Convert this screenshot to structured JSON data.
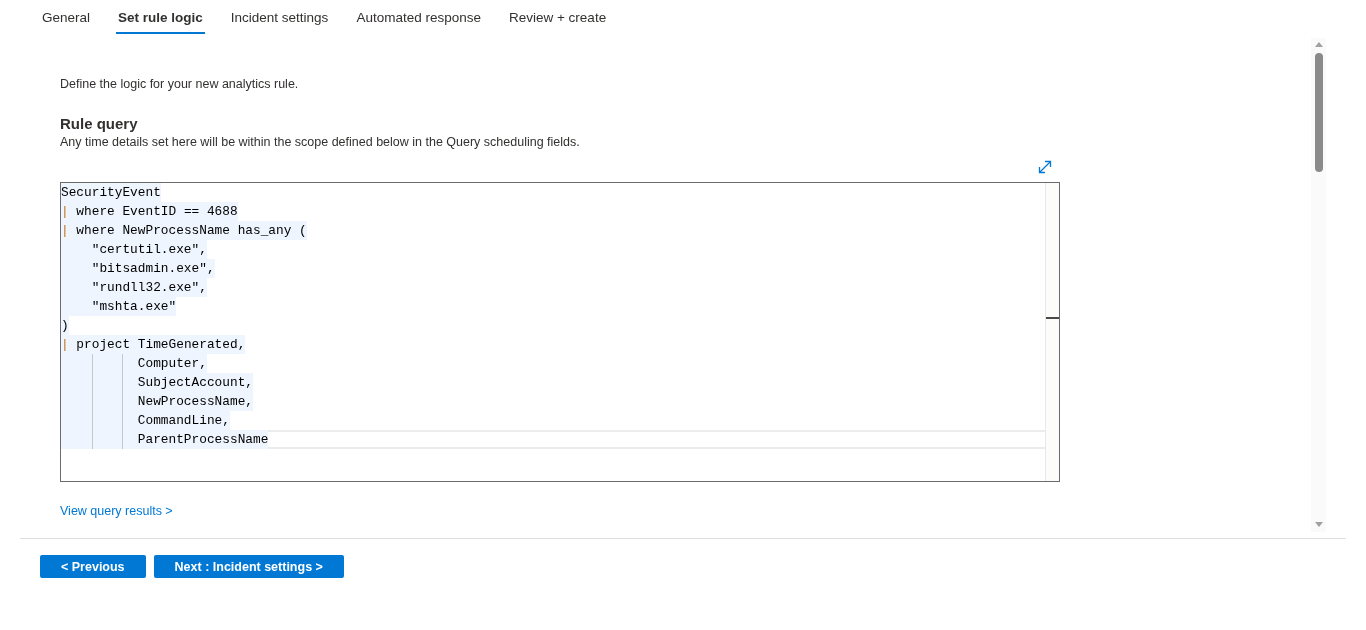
{
  "tabs": [
    {
      "label": "General",
      "selected": false
    },
    {
      "label": "Set rule logic",
      "selected": true
    },
    {
      "label": "Incident settings",
      "selected": false
    },
    {
      "label": "Automated response",
      "selected": false
    },
    {
      "label": "Review + create",
      "selected": false
    }
  ],
  "intro": "Define the logic for your new analytics rule.",
  "rule_query": {
    "title": "Rule query",
    "description": "Any time details set here will be within the scope defined below in the Query scheduling fields.",
    "editor": {
      "lines": [
        {
          "selected": true,
          "current": false,
          "segments": [
            {
              "kind": "plain",
              "text": "SecurityEvent"
            }
          ]
        },
        {
          "selected": true,
          "current": false,
          "segments": [
            {
              "kind": "operator",
              "text": "|"
            },
            {
              "kind": "plain",
              "text": " where EventID == 4688"
            }
          ]
        },
        {
          "selected": true,
          "current": false,
          "segments": [
            {
              "kind": "operator",
              "text": "|"
            },
            {
              "kind": "plain",
              "text": " where NewProcessName has_any ("
            }
          ]
        },
        {
          "selected": true,
          "current": false,
          "segments": [
            {
              "kind": "plain",
              "text": "    \"certutil.exe\","
            }
          ]
        },
        {
          "selected": true,
          "current": false,
          "segments": [
            {
              "kind": "plain",
              "text": "    \"bitsadmin.exe\","
            }
          ]
        },
        {
          "selected": true,
          "current": false,
          "segments": [
            {
              "kind": "plain",
              "text": "    \"rundll32.exe\","
            }
          ]
        },
        {
          "selected": true,
          "current": false,
          "segments": [
            {
              "kind": "plain",
              "text": "    \"mshta.exe\""
            }
          ]
        },
        {
          "selected": true,
          "current": false,
          "segments": [
            {
              "kind": "plain",
              "text": ")"
            }
          ]
        },
        {
          "selected": true,
          "current": false,
          "segments": [
            {
              "kind": "operator",
              "text": "|"
            },
            {
              "kind": "plain",
              "text": " project TimeGenerated,"
            }
          ]
        },
        {
          "selected": true,
          "current": false,
          "segments": [
            {
              "kind": "plain",
              "text": "          Computer,"
            }
          ]
        },
        {
          "selected": true,
          "current": false,
          "segments": [
            {
              "kind": "plain",
              "text": "          SubjectAccount,"
            }
          ]
        },
        {
          "selected": true,
          "current": false,
          "segments": [
            {
              "kind": "plain",
              "text": "          NewProcessName,"
            }
          ]
        },
        {
          "selected": true,
          "current": false,
          "segments": [
            {
              "kind": "plain",
              "text": "          CommandLine,"
            }
          ]
        },
        {
          "selected": true,
          "current": true,
          "segments": [
            {
              "kind": "plain",
              "text": "          ParentProcessName"
            }
          ]
        }
      ]
    }
  },
  "view_results_link": "View query results >",
  "buttons": [
    {
      "label": "< Previous"
    },
    {
      "label": "Next : Incident settings >"
    }
  ]
}
